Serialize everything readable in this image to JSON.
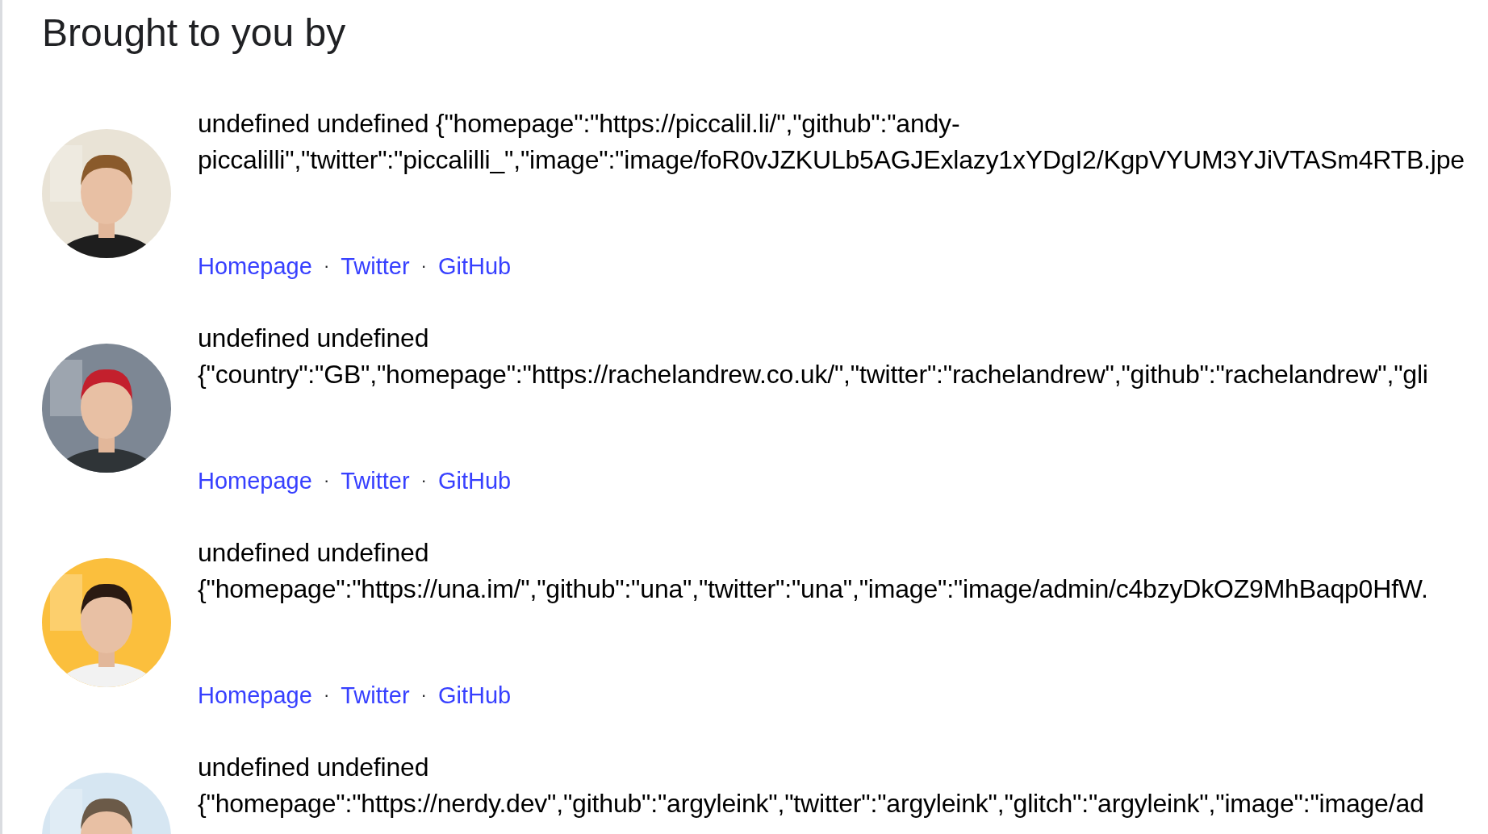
{
  "heading": "Brought to you by",
  "authors": [
    {
      "lines": [
        "undefined undefined {\"homepage\":\"https://piccalil.li/\",\"github\":\"andy-",
        "piccalilli\",\"twitter\":\"piccalilli_\",\"image\":\"image/foR0vJZKULb5AGJExlazy1xYDgI2/KgpVYUM3YJiVTASm4RTB.jpe"
      ],
      "links": [
        "Homepage",
        "Twitter",
        "GitHub"
      ],
      "separators": [
        "·",
        "·"
      ]
    },
    {
      "lines": [
        "undefined undefined",
        "{\"country\":\"GB\",\"homepage\":\"https://rachelandrew.co.uk/\",\"twitter\":\"rachelandrew\",\"github\":\"rachelandrew\",\"gli"
      ],
      "links": [
        "Homepage",
        "Twitter",
        "GitHub"
      ],
      "separators": [
        "·",
        "·"
      ]
    },
    {
      "lines": [
        "undefined undefined",
        "{\"homepage\":\"https://una.im/\",\"github\":\"una\",\"twitter\":\"una\",\"image\":\"image/admin/c4bzyDkOZ9MhBaqp0HfW."
      ],
      "links": [
        "Homepage",
        "Twitter",
        "GitHub"
      ],
      "separators": [
        "·",
        "·"
      ]
    },
    {
      "lines": [
        "undefined undefined",
        "{\"homepage\":\"https://nerdy.dev\",\"github\":\"argyleink\",\"twitter\":\"argyleink\",\"glitch\":\"argyleink\",\"image\":\"image/ad"
      ]
    }
  ]
}
